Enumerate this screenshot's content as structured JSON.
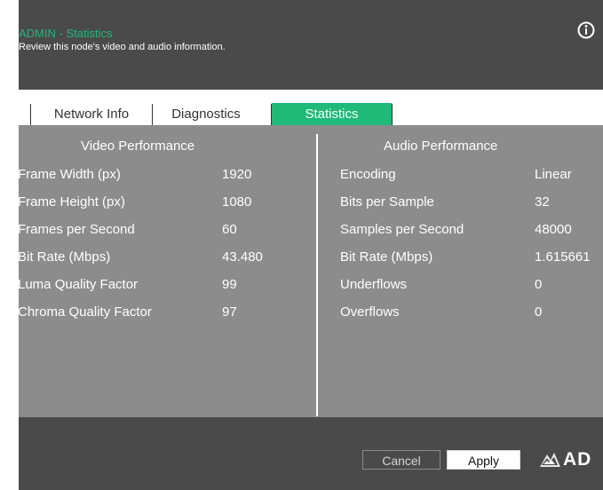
{
  "header": {
    "title": "ADMIN - Statistics",
    "subtitle": "Review this node's video and audio information."
  },
  "tabs": [
    {
      "label": "Network Info",
      "active": false
    },
    {
      "label": "Diagnostics",
      "active": false
    },
    {
      "label": "Statistics",
      "active": true
    }
  ],
  "video": {
    "title": "Video Performance",
    "rows": [
      {
        "label": "Frame Width (px)",
        "value": "1920"
      },
      {
        "label": "Frame Height (px)",
        "value": "1080"
      },
      {
        "label": "Frames per Second",
        "value": "60"
      },
      {
        "label": "Bit Rate (Mbps)",
        "value": "43.480"
      },
      {
        "label": "Luma Quality Factor",
        "value": "99"
      },
      {
        "label": "Chroma Quality Factor",
        "value": "97"
      }
    ]
  },
  "audio": {
    "title": "Audio Performance",
    "rows": [
      {
        "label": "Encoding",
        "value": "Linear"
      },
      {
        "label": "Bits per Sample",
        "value": "32"
      },
      {
        "label": "Samples per Second",
        "value": "48000"
      },
      {
        "label": "Bit Rate (Mbps)",
        "value": "1.615661"
      },
      {
        "label": "Underflows",
        "value": "0"
      },
      {
        "label": "Overflows",
        "value": "0"
      }
    ]
  },
  "footer": {
    "cancel_label": "Cancel",
    "apply_label": "Apply",
    "logo_text": "AD"
  },
  "colors": {
    "accent": "#1fb978",
    "panel": "#4a4a4b",
    "content": "#8c8c8c"
  },
  "icons": {
    "info": "info-icon",
    "logo": "adder-logo"
  }
}
